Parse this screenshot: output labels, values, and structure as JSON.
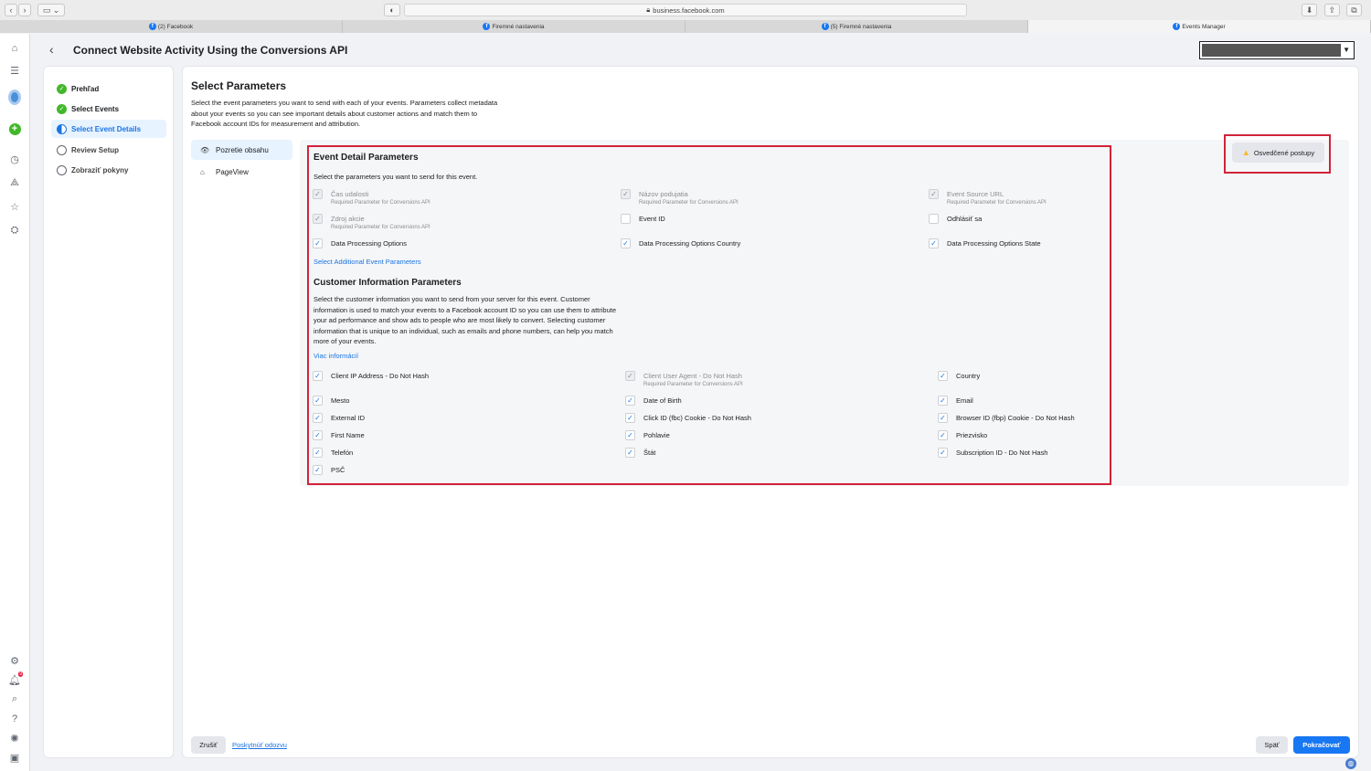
{
  "browser": {
    "url": "business.facebook.com",
    "tabs": [
      {
        "label": "(2) Facebook",
        "active": false
      },
      {
        "label": "Firemné nastavenia",
        "active": false
      },
      {
        "label": "(5) Firemné nastavenia",
        "active": false
      },
      {
        "label": "Events Manager",
        "active": true
      }
    ]
  },
  "header": {
    "title": "Connect Website Activity Using the Conversions API"
  },
  "stepper": {
    "steps": [
      {
        "label": "Prehľad",
        "state": "done"
      },
      {
        "label": "Select Events",
        "state": "done"
      },
      {
        "label": "Select Event Details",
        "state": "current"
      },
      {
        "label": "Review Setup",
        "state": "todo"
      },
      {
        "label": "Zobraziť pokyny",
        "state": "todo"
      }
    ]
  },
  "main": {
    "title": "Select Parameters",
    "description": "Select the event parameters you want to send with each of your events. Parameters collect metadata about your events so you can see important details about customer actions and match them to Facebook account IDs for measurement and attribution.",
    "events": [
      {
        "label": "Pozretie obsahu",
        "icon": "eye-icon"
      },
      {
        "label": "PageView",
        "icon": "tag-icon"
      }
    ],
    "best_practices": "Osvedčené postupy",
    "event_detail": {
      "title": "Event Detail Parameters",
      "description": "Select the parameters you want to send for this event.",
      "required_note": "Required Parameter for Conversions API",
      "params": [
        {
          "label": "Čas udalosti",
          "checked": true,
          "required": true
        },
        {
          "label": "Názov podujatia",
          "checked": true,
          "required": true
        },
        {
          "label": "Event Source URL",
          "checked": true,
          "required": true
        },
        {
          "label": "Zdroj akcie",
          "checked": true,
          "required": true
        },
        {
          "label": "Event ID",
          "checked": false,
          "required": false
        },
        {
          "label": "Odhlásiť sa",
          "checked": false,
          "required": false
        },
        {
          "label": "Data Processing Options",
          "checked": true,
          "required": false
        },
        {
          "label": "Data Processing Options Country",
          "checked": true,
          "required": false
        },
        {
          "label": "Data Processing Options State",
          "checked": true,
          "required": false
        }
      ],
      "link": "Select Additional Event Parameters"
    },
    "customer_info": {
      "title": "Customer Information Parameters",
      "description": "Select the customer information you want to send from your server for this event. Customer information is used to match your events to a Facebook account ID so you can use them to attribute your ad performance and show ads to people who are most likely to convert. Selecting customer information that is unique to an individual, such as emails and phone numbers, can help you match more of your events.",
      "link": "Viac informácií",
      "required_note": "Required Parameter for Conversions API",
      "params": [
        {
          "label": "Client IP Address - Do Not Hash",
          "checked": true,
          "required": false
        },
        {
          "label": "Client User Agent - Do Not Hash",
          "checked": true,
          "required": true
        },
        {
          "label": "Country",
          "checked": true,
          "required": false
        },
        {
          "label": "Mesto",
          "checked": true,
          "required": false
        },
        {
          "label": "Date of Birth",
          "checked": true,
          "required": false
        },
        {
          "label": "Email",
          "checked": true,
          "required": false
        },
        {
          "label": "External ID",
          "checked": true,
          "required": false
        },
        {
          "label": "Click ID (fbc) Cookie - Do Not Hash",
          "checked": true,
          "required": false
        },
        {
          "label": "Browser ID (fbp) Cookie - Do Not Hash",
          "checked": true,
          "required": false
        },
        {
          "label": "First Name",
          "checked": true,
          "required": false
        },
        {
          "label": "Pohlavie",
          "checked": true,
          "required": false
        },
        {
          "label": "Priezvisko",
          "checked": true,
          "required": false
        },
        {
          "label": "Telefón",
          "checked": true,
          "required": false
        },
        {
          "label": "Štát",
          "checked": true,
          "required": false
        },
        {
          "label": "Subscription ID - Do Not Hash",
          "checked": true,
          "required": false
        },
        {
          "label": "PSČ",
          "checked": true,
          "required": false
        }
      ]
    }
  },
  "footer": {
    "cancel": "Zrušiť",
    "feedback": "Poskytnúť odozvu",
    "back": "Späť",
    "continue": "Pokračovať"
  },
  "notifications": {
    "badge": "9"
  }
}
